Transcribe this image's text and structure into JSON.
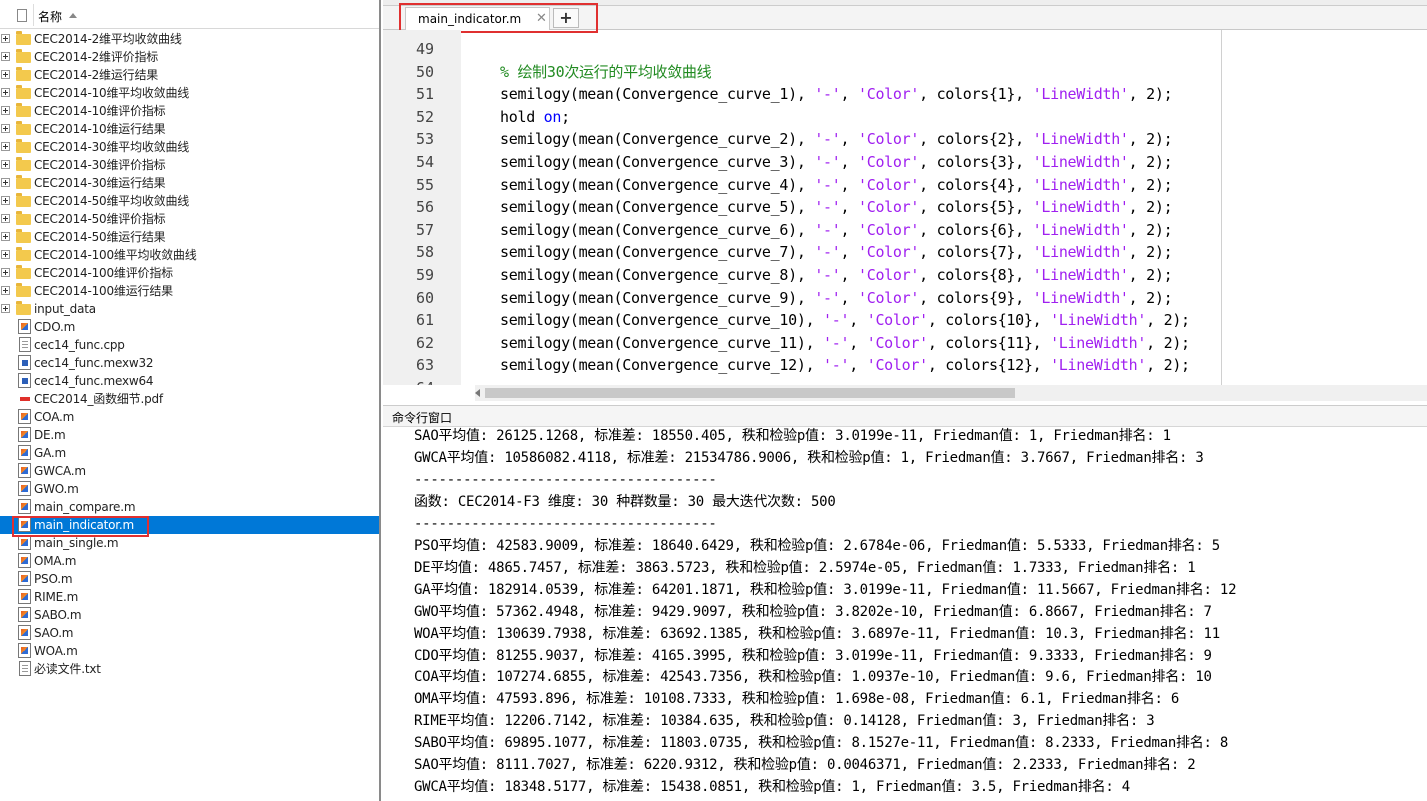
{
  "file_browser": {
    "column_header": "名称",
    "items": [
      {
        "label": "CEC2014-2维平均收敛曲线",
        "type": "folder",
        "expandable": true
      },
      {
        "label": "CEC2014-2维评价指标",
        "type": "folder",
        "expandable": true
      },
      {
        "label": "CEC2014-2维运行结果",
        "type": "folder",
        "expandable": true
      },
      {
        "label": "CEC2014-10维平均收敛曲线",
        "type": "folder",
        "expandable": true
      },
      {
        "label": "CEC2014-10维评价指标",
        "type": "folder",
        "expandable": true
      },
      {
        "label": "CEC2014-10维运行结果",
        "type": "folder",
        "expandable": true
      },
      {
        "label": "CEC2014-30维平均收敛曲线",
        "type": "folder",
        "expandable": true
      },
      {
        "label": "CEC2014-30维评价指标",
        "type": "folder",
        "expandable": true
      },
      {
        "label": "CEC2014-30维运行结果",
        "type": "folder",
        "expandable": true
      },
      {
        "label": "CEC2014-50维平均收敛曲线",
        "type": "folder",
        "expandable": true
      },
      {
        "label": "CEC2014-50维评价指标",
        "type": "folder",
        "expandable": true
      },
      {
        "label": "CEC2014-50维运行结果",
        "type": "folder",
        "expandable": true
      },
      {
        "label": "CEC2014-100维平均收敛曲线",
        "type": "folder",
        "expandable": true
      },
      {
        "label": "CEC2014-100维评价指标",
        "type": "folder",
        "expandable": true
      },
      {
        "label": "CEC2014-100维运行结果",
        "type": "folder",
        "expandable": true
      },
      {
        "label": "input_data",
        "type": "folder",
        "expandable": true
      },
      {
        "label": "CDO.m",
        "type": "m"
      },
      {
        "label": "cec14_func.cpp",
        "type": "doc"
      },
      {
        "label": "cec14_func.mexw32",
        "type": "mex"
      },
      {
        "label": "cec14_func.mexw64",
        "type": "mex"
      },
      {
        "label": "CEC2014_函数细节.pdf",
        "type": "pdf"
      },
      {
        "label": "COA.m",
        "type": "m"
      },
      {
        "label": "DE.m",
        "type": "m"
      },
      {
        "label": "GA.m",
        "type": "m"
      },
      {
        "label": "GWCA.m",
        "type": "m"
      },
      {
        "label": "GWO.m",
        "type": "m"
      },
      {
        "label": "main_compare.m",
        "type": "m"
      },
      {
        "label": "main_indicator.m",
        "type": "m",
        "selected": true
      },
      {
        "label": "main_single.m",
        "type": "m"
      },
      {
        "label": "OMA.m",
        "type": "m"
      },
      {
        "label": "PSO.m",
        "type": "m"
      },
      {
        "label": "RIME.m",
        "type": "m"
      },
      {
        "label": "SABO.m",
        "type": "m"
      },
      {
        "label": "SAO.m",
        "type": "m"
      },
      {
        "label": "WOA.m",
        "type": "m"
      },
      {
        "label": "必读文件.txt",
        "type": "doc"
      }
    ]
  },
  "editor": {
    "tab_label": "main_indicator.m",
    "close_glyph": "✕",
    "add_tab_glyph": "+",
    "lines": [
      {
        "n": "49",
        "text": ""
      },
      {
        "n": "50",
        "text": "% 绘制30次运行的平均收敛曲线"
      },
      {
        "n": "51",
        "text": "semilogy(mean(Convergence_curve_1), '-', 'Color', colors{1}, 'LineWidth', 2);"
      },
      {
        "n": "52",
        "text": "hold on;"
      },
      {
        "n": "53",
        "text": "semilogy(mean(Convergence_curve_2), '-', 'Color', colors{2}, 'LineWidth', 2);"
      },
      {
        "n": "54",
        "text": "semilogy(mean(Convergence_curve_3), '-', 'Color', colors{3}, 'LineWidth', 2);"
      },
      {
        "n": "55",
        "text": "semilogy(mean(Convergence_curve_4), '-', 'Color', colors{4}, 'LineWidth', 2);"
      },
      {
        "n": "56",
        "text": "semilogy(mean(Convergence_curve_5), '-', 'Color', colors{5}, 'LineWidth', 2);"
      },
      {
        "n": "57",
        "text": "semilogy(mean(Convergence_curve_6), '-', 'Color', colors{6}, 'LineWidth', 2);"
      },
      {
        "n": "58",
        "text": "semilogy(mean(Convergence_curve_7), '-', 'Color', colors{7}, 'LineWidth', 2);"
      },
      {
        "n": "59",
        "text": "semilogy(mean(Convergence_curve_8), '-', 'Color', colors{8}, 'LineWidth', 2);"
      },
      {
        "n": "60",
        "text": "semilogy(mean(Convergence_curve_9), '-', 'Color', colors{9}, 'LineWidth', 2);"
      },
      {
        "n": "61",
        "text": "semilogy(mean(Convergence_curve_10), '-', 'Color', colors{10}, 'LineWidth', 2);"
      },
      {
        "n": "62",
        "text": "semilogy(mean(Convergence_curve_11), '-', 'Color', colors{11}, 'LineWidth', 2);"
      },
      {
        "n": "63",
        "text": "semilogy(mean(Convergence_curve_12), '-', 'Color', colors{12}, 'LineWidth', 2);"
      },
      {
        "n": "64",
        "text": ""
      }
    ]
  },
  "command_window": {
    "title": "命令行窗口",
    "lines": [
      "SAO平均值: 26125.1268, 标准差: 18550.405, 秩和检验p值: 3.0199e-11, Friedman值: 1, Friedman排名: 1",
      "GWCA平均值: 10586082.4118, 标准差: 21534786.9006, 秩和检验p值: 1, Friedman值: 3.7667, Friedman排名: 3",
      "-------------------------------------",
      "函数: CEC2014-F3 维度: 30 种群数量: 30 最大迭代次数: 500",
      "-------------------------------------",
      "PSO平均值: 42583.9009, 标准差: 18640.6429, 秩和检验p值: 2.6784e-06, Friedman值: 5.5333, Friedman排名: 5",
      "DE平均值: 4865.7457, 标准差: 3863.5723, 秩和检验p值: 2.5974e-05, Friedman值: 1.7333, Friedman排名: 1",
      "GA平均值: 182914.0539, 标准差: 64201.1871, 秩和检验p值: 3.0199e-11, Friedman值: 11.5667, Friedman排名: 12",
      "GWO平均值: 57362.4948, 标准差: 9429.9097, 秩和检验p值: 3.8202e-10, Friedman值: 6.8667, Friedman排名: 7",
      "WOA平均值: 130639.7938, 标准差: 63692.1385, 秩和检验p值: 3.6897e-11, Friedman值: 10.3, Friedman排名: 11",
      "CDO平均值: 81255.9037, 标准差: 4165.3995, 秩和检验p值: 3.0199e-11, Friedman值: 9.3333, Friedman排名: 9",
      "COA平均值: 107274.6855, 标准差: 42543.7356, 秩和检验p值: 1.0937e-10, Friedman值: 9.6, Friedman排名: 10",
      "OMA平均值: 47593.896, 标准差: 10108.7333, 秩和检验p值: 1.698e-08, Friedman值: 6.1, Friedman排名: 6",
      "RIME平均值: 12206.7142, 标准差: 10384.635, 秩和检验p值: 0.14128, Friedman值: 3, Friedman排名: 3",
      "SABO平均值: 69895.1077, 标准差: 11803.0735, 秩和检验p值: 8.1527e-11, Friedman值: 8.2333, Friedman排名: 8",
      "SAO平均值: 8111.7027, 标准差: 6220.9312, 秩和检验p值: 0.0046371, Friedman值: 2.2333, Friedman排名: 2",
      "GWCA平均值: 18348.5177, 标准差: 15438.0851, 秩和检验p值: 1, Friedman值: 3.5, Friedman排名: 4"
    ]
  },
  "colors": {
    "selection": "#0078d7",
    "highlight_box": "#e03030",
    "keyword": "#0000ff",
    "string": "#a020f0",
    "comment": "#228b22"
  }
}
